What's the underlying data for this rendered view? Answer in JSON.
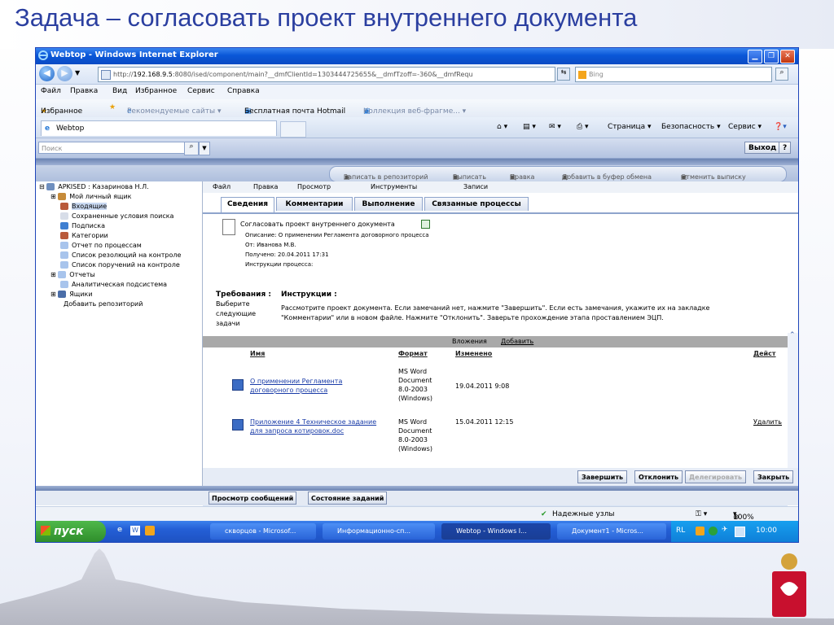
{
  "slide": {
    "title": "Задача – согласовать проект внутреннего документа"
  },
  "ie": {
    "window_title": "Webtop - Windows Internet Explorer",
    "url_prefix": "http://",
    "url_host": "192.168.9.5",
    "url_rest": ":8080/ised/component/main?__dmfClientId=1303444725655&__dmfTzoff=-360&__dmfRequ",
    "search_placeholder": "Bing",
    "menu": [
      "Файл",
      "Правка",
      "Вид",
      "Избранное",
      "Сервис",
      "Справка"
    ],
    "favorites_label": "Избранное",
    "fav_links": [
      "Рекомендуемые сайты ▾",
      "Бесплатная почта Hotmail",
      "Коллекция веб-фрагме... ▾"
    ],
    "tab_label": "Webtop",
    "toolbar_right": [
      "Страница ▾",
      "Безопасность ▾",
      "Сервис ▾"
    ],
    "status_zone": "Надежные узлы",
    "zoom": "100%"
  },
  "webtop": {
    "search_placeholder": "Поиск",
    "logout": "Выход",
    "help": "?",
    "commands": [
      "Записать в репозиторий",
      "Выписать",
      "Правка",
      "Добавить в буфер обмена",
      "Отменить выписку"
    ],
    "tree": [
      {
        "label": "APKISED : Казаринова Н.Л."
      },
      {
        "label": "Мой личный ящик"
      },
      {
        "label": "Входящие"
      },
      {
        "label": "Сохраненные условия поиска"
      },
      {
        "label": "Подписка"
      },
      {
        "label": "Категории"
      },
      {
        "label": "Отчет по процессам"
      },
      {
        "label": "Список резолюций на контроле"
      },
      {
        "label": "Список поручений на контроле"
      },
      {
        "label": "Отчеты"
      },
      {
        "label": "Аналитическая подсистема"
      },
      {
        "label": "Ящики"
      },
      {
        "label": "Добавить репозиторий"
      }
    ],
    "content_menu": [
      "Файл",
      "Правка",
      "Просмотр",
      "Инструменты",
      "Записи"
    ],
    "tabs": [
      "Сведения",
      "Комментарии",
      "Выполнение",
      "Связанные процессы"
    ],
    "task": {
      "title": "Согласовать проект внутреннего документа",
      "description": "Описание:   О применении Регламента договорного процесса",
      "from": "От:   Иванова М.В.",
      "received": "Получено: 20.04.2011 17:31",
      "instructions_label": "Инструкции процесса:"
    },
    "requirements_label": "Требования :",
    "requirements_text": [
      "Выберите",
      "следующие",
      "задачи"
    ],
    "instructions_title": "Инструкции :",
    "instructions_text": [
      "Рассмотрите проект документа. Если замечаний нет, нажмите \"Завершить\". Если есть замечания, укажите их на закладке",
      "\"Комментарии\" или в новом файле. Нажмите \"Отклонить\". Заверьте прохождение этапа проставлением ЭЦП."
    ],
    "attachments_label": "Вложения",
    "attachments_add": "Добавить",
    "columns": {
      "name": "Имя",
      "format": "Формат",
      "modified": "Изменено",
      "action": "Дейст"
    },
    "attachments": [
      {
        "name": "О применении Регламента\nдоговорного процесса",
        "format": "MS Word\nDocument\n8.0-2003\n(Windows)",
        "modified": "19.04.2011 9:08",
        "action": ""
      },
      {
        "name": "Приложение 4 Техническое задание\nдля запроса котировок.doc",
        "format": "MS Word\nDocument\n8.0-2003\n(Windows)",
        "modified": "15.04.2011 12:15",
        "action": "Удалить"
      }
    ],
    "actions": [
      "Завершить",
      "Отклонить",
      "Делегировать",
      "Закрыть"
    ],
    "bottom_tabs": [
      "Просмотр сообщений",
      "Состояние заданий"
    ]
  },
  "taskbar": {
    "start": "пуск",
    "items": [
      "скворцов - Microsof...",
      "Информационно-сп...",
      "Webtop - Windows I...",
      "Документ1 - Micros..."
    ],
    "lang": "RL",
    "clock": "10:00"
  },
  "colors": {
    "title_blue": "#2b3fa0",
    "xp_titlebar": "#0a57d8",
    "taskbar": "#245fd6",
    "start_green": "#3ea03a"
  }
}
